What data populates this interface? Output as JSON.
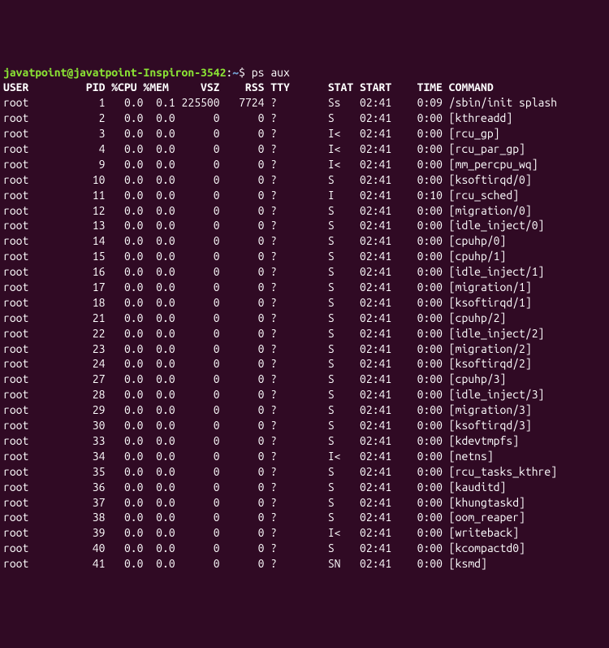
{
  "prompt": {
    "user": "javatpoint",
    "at": "@",
    "host": "javatpoint-Inspiron-3542",
    "colon": ":",
    "path": "~",
    "dollar": "$",
    "command": "ps aux"
  },
  "headers": {
    "user": "USER",
    "pid": "PID",
    "cpu": "%CPU",
    "mem": "%MEM",
    "vsz": "VSZ",
    "rss": "RSS",
    "tty": "TTY",
    "stat": "STAT",
    "start": "START",
    "time": "TIME",
    "command": "COMMAND"
  },
  "rows": [
    {
      "user": "root",
      "pid": "1",
      "cpu": "0.0",
      "mem": "0.1",
      "vsz": "225500",
      "rss": "7724",
      "tty": "?",
      "stat": "Ss",
      "start": "02:41",
      "time": "0:09",
      "command": "/sbin/init splash"
    },
    {
      "user": "root",
      "pid": "2",
      "cpu": "0.0",
      "mem": "0.0",
      "vsz": "0",
      "rss": "0",
      "tty": "?",
      "stat": "S",
      "start": "02:41",
      "time": "0:00",
      "command": "[kthreadd]"
    },
    {
      "user": "root",
      "pid": "3",
      "cpu": "0.0",
      "mem": "0.0",
      "vsz": "0",
      "rss": "0",
      "tty": "?",
      "stat": "I<",
      "start": "02:41",
      "time": "0:00",
      "command": "[rcu_gp]"
    },
    {
      "user": "root",
      "pid": "4",
      "cpu": "0.0",
      "mem": "0.0",
      "vsz": "0",
      "rss": "0",
      "tty": "?",
      "stat": "I<",
      "start": "02:41",
      "time": "0:00",
      "command": "[rcu_par_gp]"
    },
    {
      "user": "root",
      "pid": "9",
      "cpu": "0.0",
      "mem": "0.0",
      "vsz": "0",
      "rss": "0",
      "tty": "?",
      "stat": "I<",
      "start": "02:41",
      "time": "0:00",
      "command": "[mm_percpu_wq]"
    },
    {
      "user": "root",
      "pid": "10",
      "cpu": "0.0",
      "mem": "0.0",
      "vsz": "0",
      "rss": "0",
      "tty": "?",
      "stat": "S",
      "start": "02:41",
      "time": "0:00",
      "command": "[ksoftirqd/0]"
    },
    {
      "user": "root",
      "pid": "11",
      "cpu": "0.0",
      "mem": "0.0",
      "vsz": "0",
      "rss": "0",
      "tty": "?",
      "stat": "I",
      "start": "02:41",
      "time": "0:10",
      "command": "[rcu_sched]"
    },
    {
      "user": "root",
      "pid": "12",
      "cpu": "0.0",
      "mem": "0.0",
      "vsz": "0",
      "rss": "0",
      "tty": "?",
      "stat": "S",
      "start": "02:41",
      "time": "0:00",
      "command": "[migration/0]"
    },
    {
      "user": "root",
      "pid": "13",
      "cpu": "0.0",
      "mem": "0.0",
      "vsz": "0",
      "rss": "0",
      "tty": "?",
      "stat": "S",
      "start": "02:41",
      "time": "0:00",
      "command": "[idle_inject/0]"
    },
    {
      "user": "root",
      "pid": "14",
      "cpu": "0.0",
      "mem": "0.0",
      "vsz": "0",
      "rss": "0",
      "tty": "?",
      "stat": "S",
      "start": "02:41",
      "time": "0:00",
      "command": "[cpuhp/0]"
    },
    {
      "user": "root",
      "pid": "15",
      "cpu": "0.0",
      "mem": "0.0",
      "vsz": "0",
      "rss": "0",
      "tty": "?",
      "stat": "S",
      "start": "02:41",
      "time": "0:00",
      "command": "[cpuhp/1]"
    },
    {
      "user": "root",
      "pid": "16",
      "cpu": "0.0",
      "mem": "0.0",
      "vsz": "0",
      "rss": "0",
      "tty": "?",
      "stat": "S",
      "start": "02:41",
      "time": "0:00",
      "command": "[idle_inject/1]"
    },
    {
      "user": "root",
      "pid": "17",
      "cpu": "0.0",
      "mem": "0.0",
      "vsz": "0",
      "rss": "0",
      "tty": "?",
      "stat": "S",
      "start": "02:41",
      "time": "0:00",
      "command": "[migration/1]"
    },
    {
      "user": "root",
      "pid": "18",
      "cpu": "0.0",
      "mem": "0.0",
      "vsz": "0",
      "rss": "0",
      "tty": "?",
      "stat": "S",
      "start": "02:41",
      "time": "0:00",
      "command": "[ksoftirqd/1]"
    },
    {
      "user": "root",
      "pid": "21",
      "cpu": "0.0",
      "mem": "0.0",
      "vsz": "0",
      "rss": "0",
      "tty": "?",
      "stat": "S",
      "start": "02:41",
      "time": "0:00",
      "command": "[cpuhp/2]"
    },
    {
      "user": "root",
      "pid": "22",
      "cpu": "0.0",
      "mem": "0.0",
      "vsz": "0",
      "rss": "0",
      "tty": "?",
      "stat": "S",
      "start": "02:41",
      "time": "0:00",
      "command": "[idle_inject/2]"
    },
    {
      "user": "root",
      "pid": "23",
      "cpu": "0.0",
      "mem": "0.0",
      "vsz": "0",
      "rss": "0",
      "tty": "?",
      "stat": "S",
      "start": "02:41",
      "time": "0:00",
      "command": "[migration/2]"
    },
    {
      "user": "root",
      "pid": "24",
      "cpu": "0.0",
      "mem": "0.0",
      "vsz": "0",
      "rss": "0",
      "tty": "?",
      "stat": "S",
      "start": "02:41",
      "time": "0:00",
      "command": "[ksoftirqd/2]"
    },
    {
      "user": "root",
      "pid": "27",
      "cpu": "0.0",
      "mem": "0.0",
      "vsz": "0",
      "rss": "0",
      "tty": "?",
      "stat": "S",
      "start": "02:41",
      "time": "0:00",
      "command": "[cpuhp/3]"
    },
    {
      "user": "root",
      "pid": "28",
      "cpu": "0.0",
      "mem": "0.0",
      "vsz": "0",
      "rss": "0",
      "tty": "?",
      "stat": "S",
      "start": "02:41",
      "time": "0:00",
      "command": "[idle_inject/3]"
    },
    {
      "user": "root",
      "pid": "29",
      "cpu": "0.0",
      "mem": "0.0",
      "vsz": "0",
      "rss": "0",
      "tty": "?",
      "stat": "S",
      "start": "02:41",
      "time": "0:00",
      "command": "[migration/3]"
    },
    {
      "user": "root",
      "pid": "30",
      "cpu": "0.0",
      "mem": "0.0",
      "vsz": "0",
      "rss": "0",
      "tty": "?",
      "stat": "S",
      "start": "02:41",
      "time": "0:00",
      "command": "[ksoftirqd/3]"
    },
    {
      "user": "root",
      "pid": "33",
      "cpu": "0.0",
      "mem": "0.0",
      "vsz": "0",
      "rss": "0",
      "tty": "?",
      "stat": "S",
      "start": "02:41",
      "time": "0:00",
      "command": "[kdevtmpfs]"
    },
    {
      "user": "root",
      "pid": "34",
      "cpu": "0.0",
      "mem": "0.0",
      "vsz": "0",
      "rss": "0",
      "tty": "?",
      "stat": "I<",
      "start": "02:41",
      "time": "0:00",
      "command": "[netns]"
    },
    {
      "user": "root",
      "pid": "35",
      "cpu": "0.0",
      "mem": "0.0",
      "vsz": "0",
      "rss": "0",
      "tty": "?",
      "stat": "S",
      "start": "02:41",
      "time": "0:00",
      "command": "[rcu_tasks_kthre]"
    },
    {
      "user": "root",
      "pid": "36",
      "cpu": "0.0",
      "mem": "0.0",
      "vsz": "0",
      "rss": "0",
      "tty": "?",
      "stat": "S",
      "start": "02:41",
      "time": "0:00",
      "command": "[kauditd]"
    },
    {
      "user": "root",
      "pid": "37",
      "cpu": "0.0",
      "mem": "0.0",
      "vsz": "0",
      "rss": "0",
      "tty": "?",
      "stat": "S",
      "start": "02:41",
      "time": "0:00",
      "command": "[khungtaskd]"
    },
    {
      "user": "root",
      "pid": "38",
      "cpu": "0.0",
      "mem": "0.0",
      "vsz": "0",
      "rss": "0",
      "tty": "?",
      "stat": "S",
      "start": "02:41",
      "time": "0:00",
      "command": "[oom_reaper]"
    },
    {
      "user": "root",
      "pid": "39",
      "cpu": "0.0",
      "mem": "0.0",
      "vsz": "0",
      "rss": "0",
      "tty": "?",
      "stat": "I<",
      "start": "02:41",
      "time": "0:00",
      "command": "[writeback]"
    },
    {
      "user": "root",
      "pid": "40",
      "cpu": "0.0",
      "mem": "0.0",
      "vsz": "0",
      "rss": "0",
      "tty": "?",
      "stat": "S",
      "start": "02:41",
      "time": "0:00",
      "command": "[kcompactd0]"
    },
    {
      "user": "root",
      "pid": "41",
      "cpu": "0.0",
      "mem": "0.0",
      "vsz": "0",
      "rss": "0",
      "tty": "?",
      "stat": "SN",
      "start": "02:41",
      "time": "0:00",
      "command": "[ksmd]"
    }
  ],
  "widths": {
    "user": 9,
    "pid": 7,
    "cpu": 5,
    "mem": 5,
    "vsz": 7,
    "rss": 7,
    "tty": 9,
    "stat": 5,
    "start": 6,
    "time": 7
  }
}
